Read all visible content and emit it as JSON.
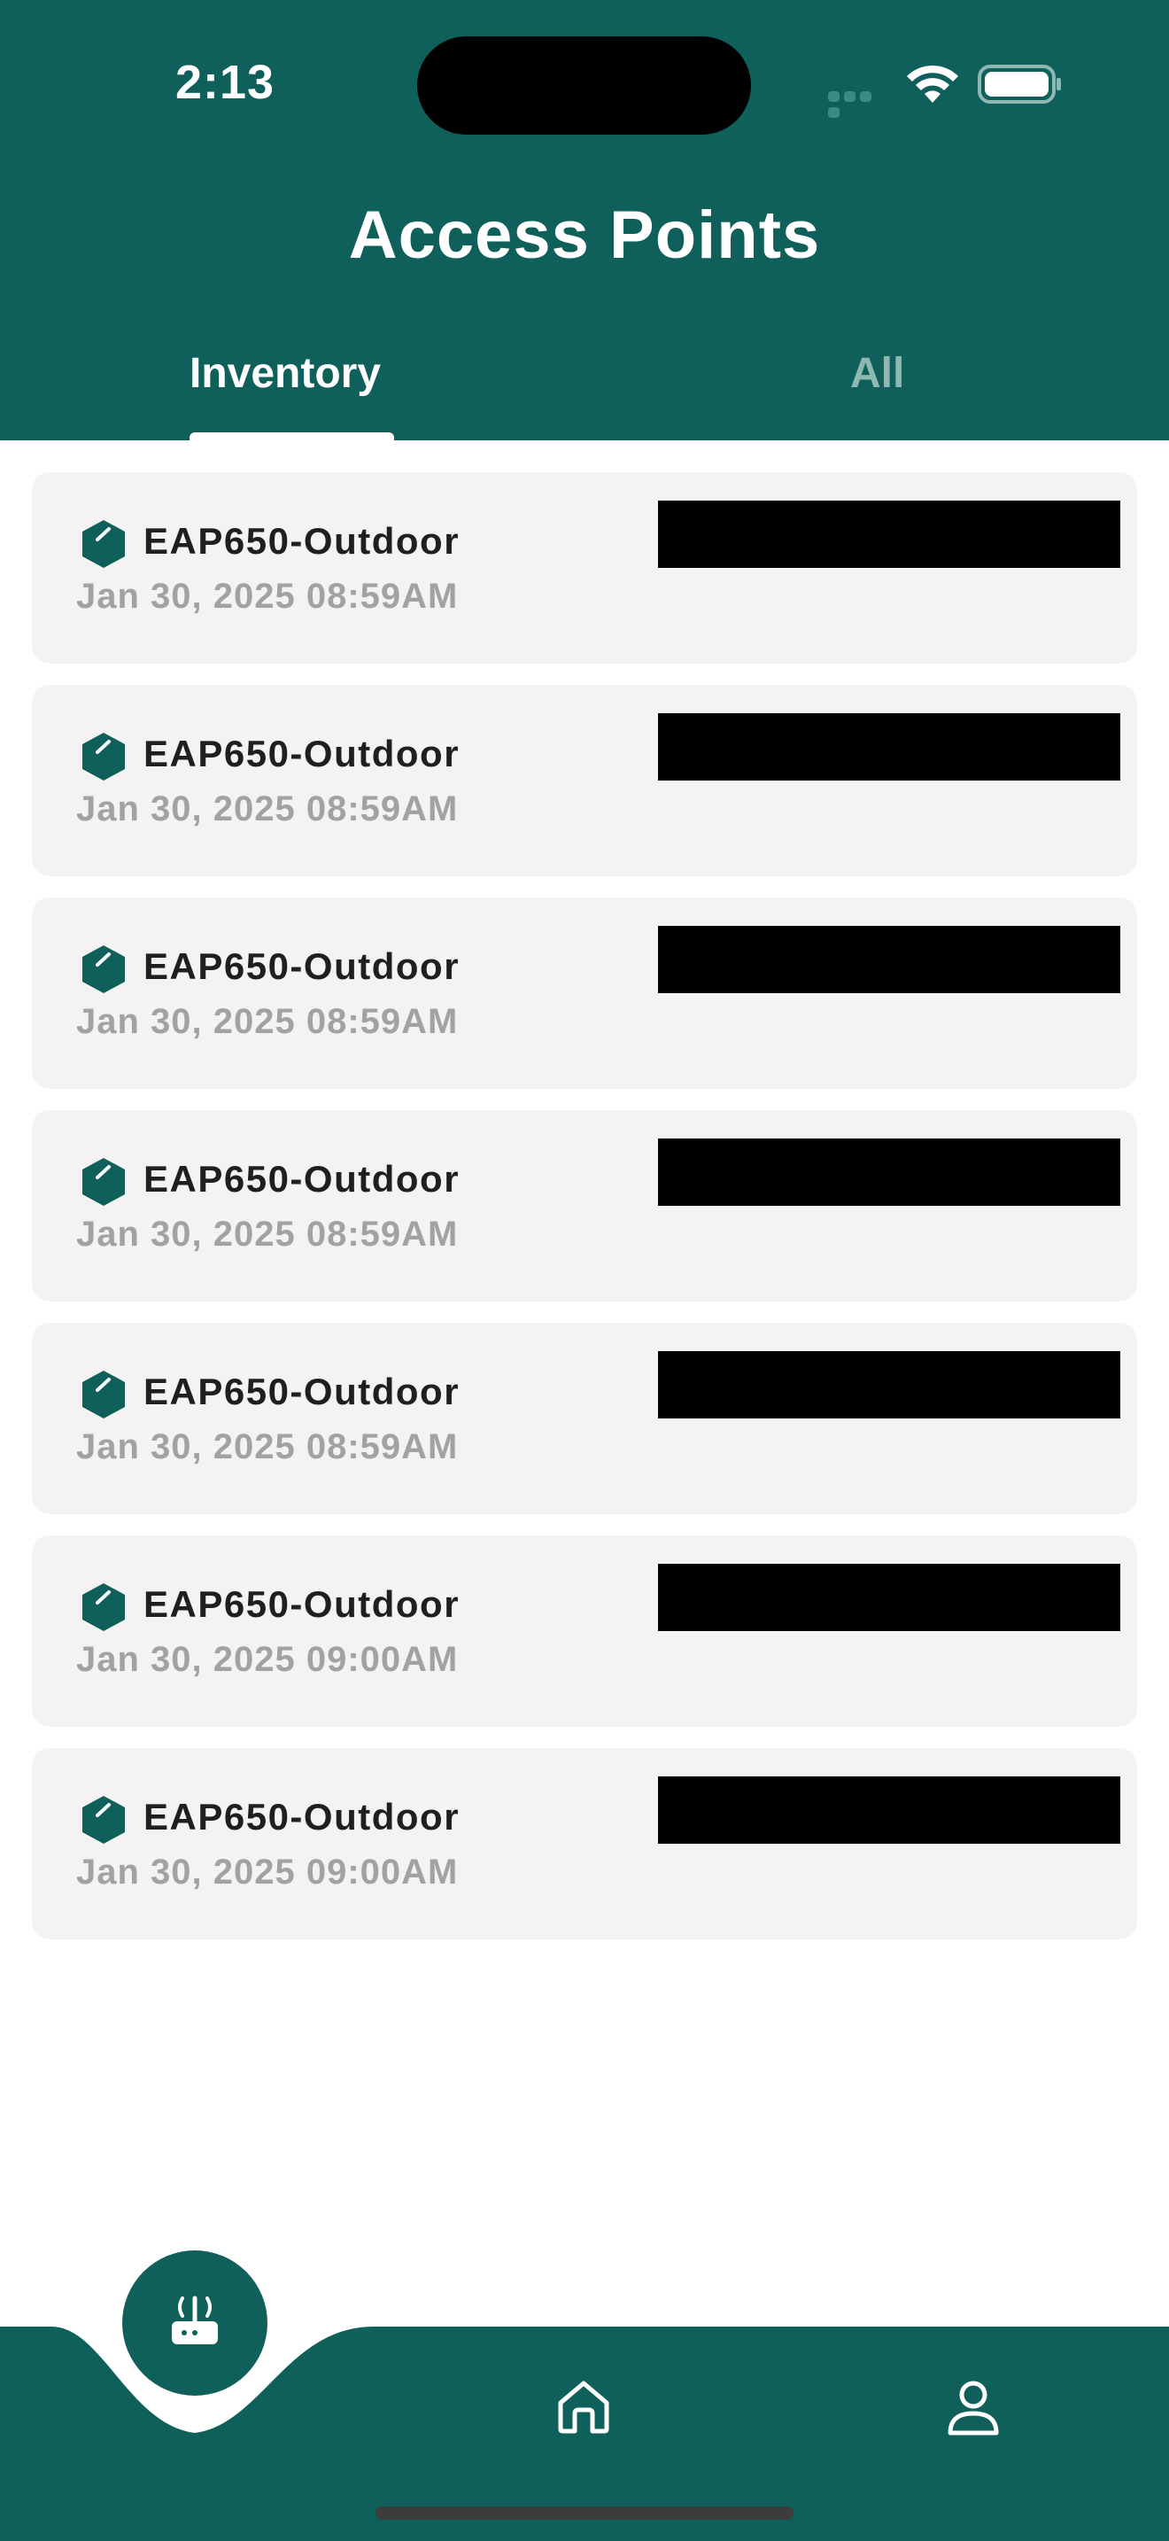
{
  "status_bar": {
    "time": "2:13"
  },
  "header": {
    "title": "Access Points"
  },
  "tabs": [
    {
      "label": "Inventory",
      "selected": true
    },
    {
      "label": "All",
      "selected": false
    }
  ],
  "items": [
    {
      "name": "EAP650-Outdoor",
      "date": "Jan 30, 2025 08:59AM",
      "icon": "box-icon"
    },
    {
      "name": "EAP650-Outdoor",
      "date": "Jan 30, 2025 08:59AM",
      "icon": "box-icon"
    },
    {
      "name": "EAP650-Outdoor",
      "date": "Jan 30, 2025 08:59AM",
      "icon": "box-icon"
    },
    {
      "name": "EAP650-Outdoor",
      "date": "Jan 30, 2025 08:59AM",
      "icon": "box-icon"
    },
    {
      "name": "EAP650-Outdoor",
      "date": "Jan 30, 2025 08:59AM",
      "icon": "box-icon"
    },
    {
      "name": "EAP650-Outdoor",
      "date": "Jan 30, 2025 09:00AM",
      "icon": "box-icon"
    },
    {
      "name": "EAP650-Outdoor",
      "date": "Jan 30, 2025 09:00AM",
      "icon": "box-icon"
    }
  ],
  "bottom_nav": {
    "items": [
      {
        "icon": "router-icon",
        "active": true
      },
      {
        "icon": "home-icon",
        "active": false
      },
      {
        "icon": "profile-icon",
        "active": false
      }
    ]
  },
  "colors": {
    "primary": "#0f5f5a",
    "card_background": "#f3f3f3",
    "date_text": "#a2a2a2",
    "inactive_tab": "#8fb8b3"
  }
}
